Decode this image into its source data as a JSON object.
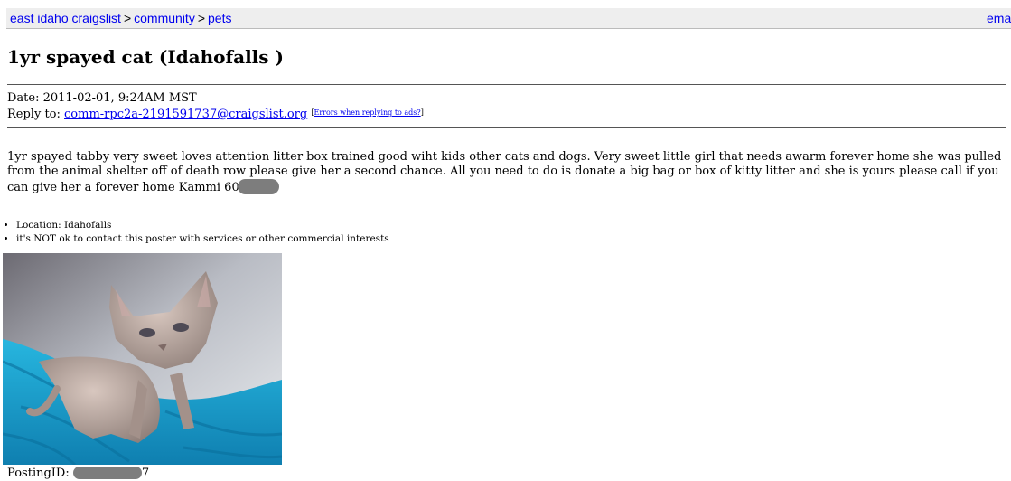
{
  "breadcrumb": {
    "site": "east idaho craigslist",
    "separator": ">",
    "section": "community",
    "category": "pets",
    "email_link": "ema"
  },
  "post": {
    "title": "1yr spayed cat (Idahofalls )",
    "date": "Date: 2011-02-01, 9:24AM MST",
    "reply_label": "Reply to:",
    "reply_email": "comm-rpc2a-2191591737@craigslist.org",
    "reply_errors_link": "Errors when replying to ads?",
    "body": "1yr spayed tabby very sweet loves attention litter box trained good wiht kids other cats and dogs. Very sweet little girl that needs awarm forever home she was pulled from the animal shelter off of death row please give her a second chance. All you need to do is donate a big bag or box of kitty litter and she is yours please call if you can give her a forever home Kammi 60",
    "blurbs": [
      "Location: Idahofalls",
      "it's NOT ok to contact this poster with services or other commercial interests"
    ],
    "posting_id_label": "PostingID:",
    "posting_id_tail": "7"
  },
  "colors": {
    "link": "#0000ee",
    "crumb_bg": "#eeeeee",
    "redaction": "#7d7d7d",
    "blanket": "#1fa3c9"
  },
  "icons": {
    "photo": "hairless-kitten-photo"
  }
}
